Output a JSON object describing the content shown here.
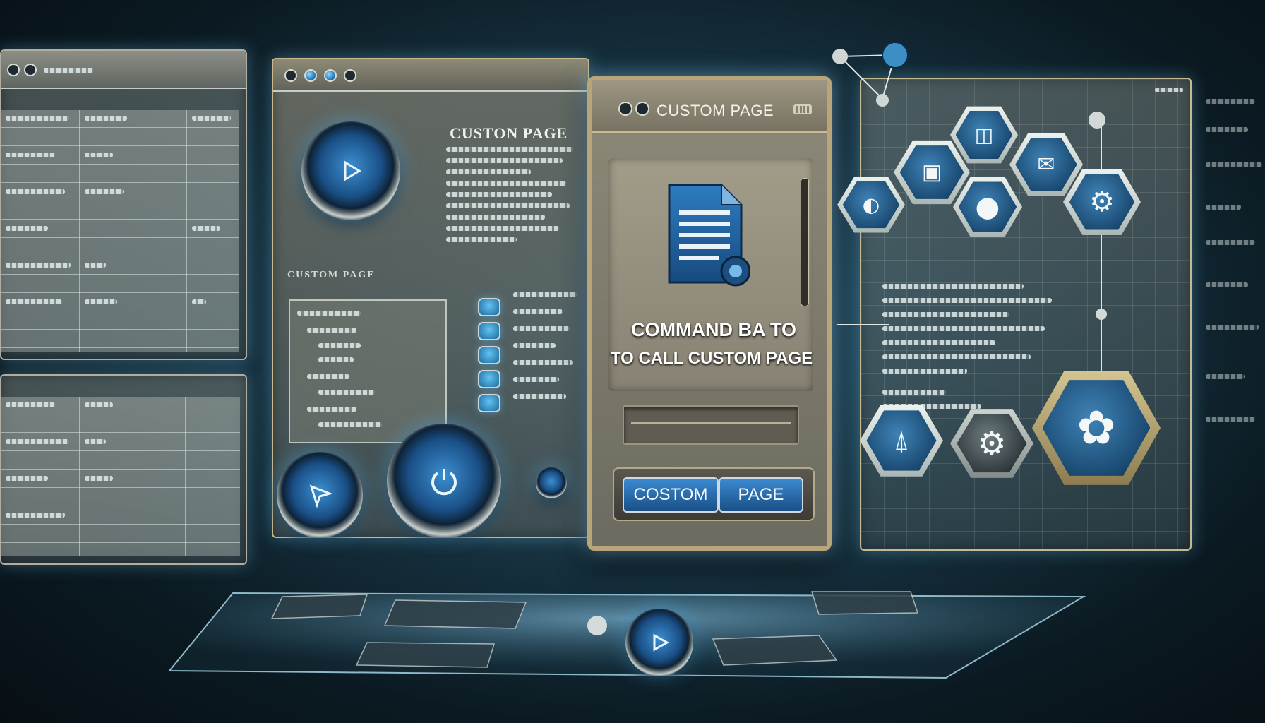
{
  "main_window": {
    "title": "CUSTOM PAGE",
    "headline_line1": "COMMAND BA TO",
    "headline_line2": "TO CALL CUSTOM PAGE",
    "button_left": "COSTOM",
    "button_right": "PAGE"
  },
  "middle_panel": {
    "heading": "CUSTON PAGE",
    "subheading": "CUSTOM PAGE"
  },
  "colors": {
    "accent_blue": "#1f5f96",
    "glow": "#7ccfff",
    "frame": "#b9a57a"
  },
  "icons": [
    "play-icon",
    "document-icon",
    "search-icon",
    "settings-icon",
    "network-icon"
  ]
}
